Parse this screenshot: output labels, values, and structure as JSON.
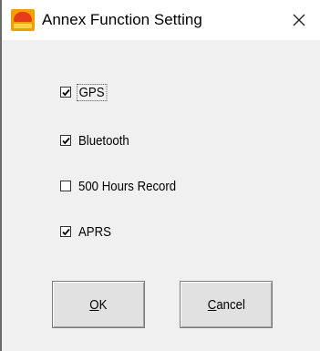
{
  "window": {
    "title": "Annex Function Setting",
    "close_icon": "close-icon"
  },
  "options": [
    {
      "label": "GPS",
      "checked": true
    },
    {
      "label": "Bluetooth",
      "checked": true
    },
    {
      "label": "500 Hours Record",
      "checked": false
    },
    {
      "label": "APRS",
      "checked": true
    }
  ],
  "buttons": {
    "ok": {
      "mnemonic": "O",
      "rest": "K"
    },
    "cancel": {
      "mnemonic": "C",
      "rest": "ancel"
    }
  }
}
